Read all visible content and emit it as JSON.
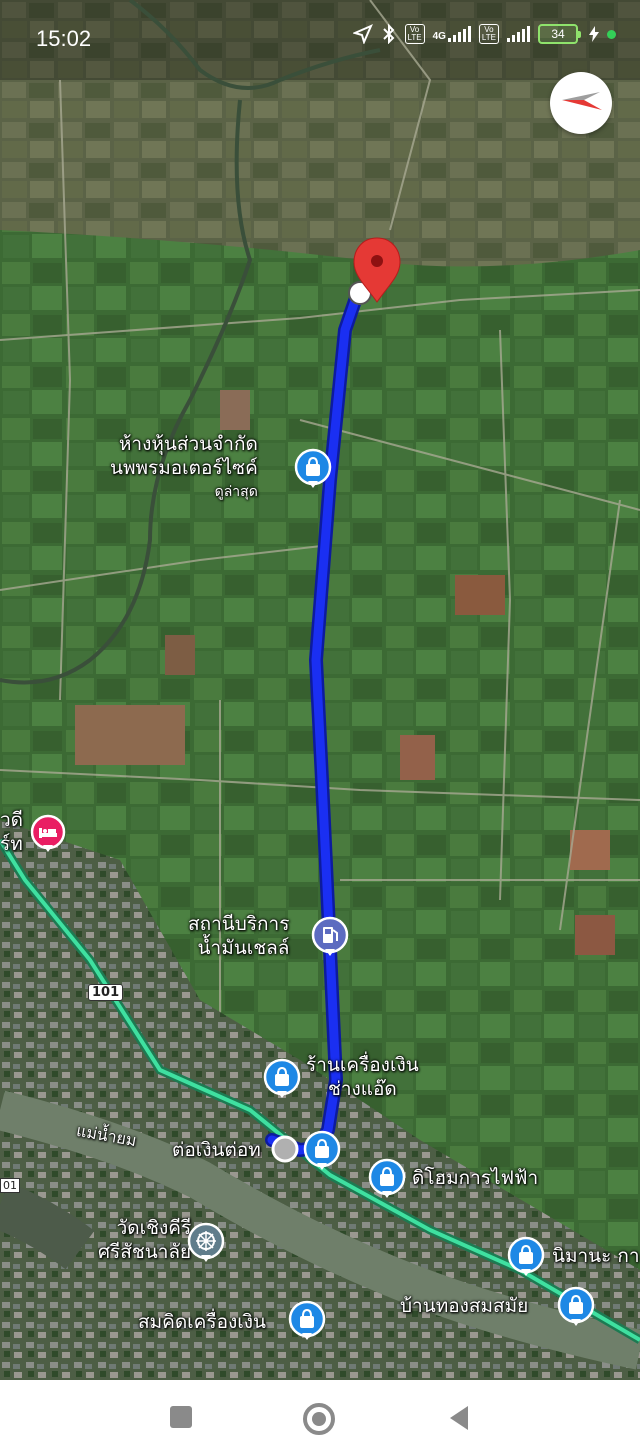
{
  "status_bar": {
    "time": "15:02",
    "icons": [
      "location-arrow-icon",
      "bluetooth-icon",
      "volte-icon",
      "signal-4g-icon",
      "volte-icon",
      "signal-icon"
    ],
    "network_label_1": "Vo\nLTE",
    "network_type": "4G",
    "network_label_2": "Vo\nLTE",
    "battery_level": "34",
    "charging": true
  },
  "map": {
    "view": "satellite",
    "route_color": "#1a2ff2",
    "places": {
      "motor_shop_line1": "ห้างหุ้นส่วนจำกัด",
      "motor_shop_line2": "นพพรมอเตอร์ไซค์",
      "motor_shop_sub": "ดูล่าสุด",
      "resort_line1": "วดี",
      "resort_line2": "ร์ท",
      "gas_line1": "สถานีบริการ",
      "gas_line2": "น้ำมันเชลล์",
      "highway_number": "101",
      "jewelry_line1": "ร้านเครื่องเงิน",
      "jewelry_line2": "ช่างแอ๊ด",
      "river": "แม่น้ำยม",
      "toengin": "ต่อเงินต่อท",
      "road_edge": "01",
      "electric_shop": "ดิโฮมการไฟฟ้า",
      "temple_line1": "วัดเชิงคีรี",
      "temple_line2": "ศรีสัชนาลัย",
      "nimana": "นิมานะ กา",
      "gold_shop": "บ้านทองสมสมัย",
      "silver_shop": "สมคิดเครื่องเงิน"
    }
  },
  "nav_bar": {
    "buttons": [
      "recents-square-icon",
      "home-circle-icon",
      "back-triangle-icon"
    ]
  }
}
